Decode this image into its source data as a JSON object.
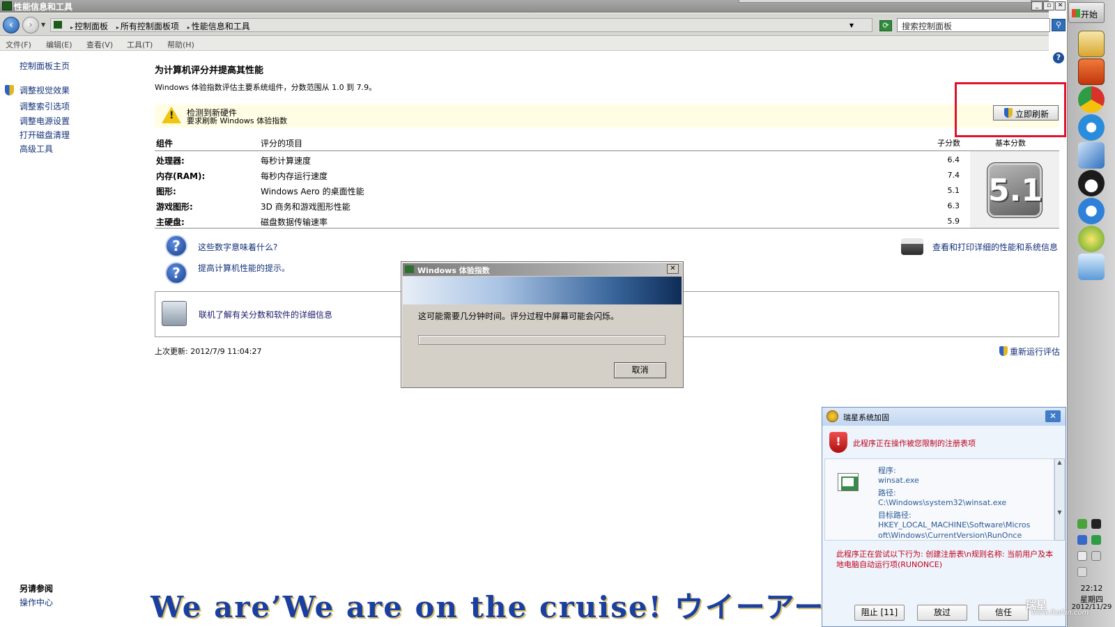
{
  "window": {
    "title": "性能信息和工具",
    "buttons": {
      "minimize": "_",
      "restore": "▫",
      "close": "✕"
    }
  },
  "address": {
    "crumbs": [
      "控制面板",
      "所有控制面板项",
      "性能信息和工具"
    ],
    "search_placeholder": "搜索控制面板"
  },
  "menu": [
    "文件(F)",
    "编辑(E)",
    "查看(V)",
    "工具(T)",
    "帮助(H)"
  ],
  "sidebar": {
    "home": "控制面板主页",
    "links": [
      "调整视觉效果",
      "调整索引选项",
      "调整电源设置",
      "打开磁盘清理",
      "高级工具"
    ],
    "see_also_title": "另请参阅",
    "see_also_link": "操作中心"
  },
  "main": {
    "heading": "为计算机评分并提高其性能",
    "subheading": "Windows 体验指数评估主要系统组件，分数范围从 1.0 到 7.9。",
    "alert": {
      "line1": "检测到新硬件",
      "line2": "要求刷新 Windows 体验指数"
    },
    "refresh_button": "立即刷新",
    "table": {
      "headers": {
        "component": "组件",
        "rated": "评分的项目",
        "subscore": "子分数",
        "basescore": "基本分数"
      },
      "rows": [
        {
          "component": "处理器:",
          "item": "每秒计算速度",
          "score": "6.4"
        },
        {
          "component": "内存(RAM):",
          "item": "每秒内存运行速度",
          "score": "7.4"
        },
        {
          "component": "图形:",
          "item": "Windows Aero 的桌面性能",
          "score": "5.1"
        },
        {
          "component": "游戏图形:",
          "item": "3D 商务和游戏图形性能",
          "score": "6.3"
        },
        {
          "component": "主硬盘:",
          "item": "磁盘数据传输速率",
          "score": "5.9"
        }
      ],
      "base_score": "5.1"
    },
    "help_links": [
      "这些数字意味着什么?",
      "提高计算机性能的提示。"
    ],
    "print_link": "查看和打印详细的性能和系统信息",
    "online_link": "联机了解有关分数和软件的详细信息",
    "last_update": "上次更新: 2012/7/9 11:04:27",
    "rerun_link": "重新运行评估"
  },
  "modal": {
    "title": "Windows 体验指数",
    "message": "这可能需要几分钟时间。评分过程中屏幕可能会闪烁。",
    "cancel": "取消",
    "close": "✕",
    "progress": 0
  },
  "caption": "We are’We are on the cruise! ウイーアー",
  "security_popup": {
    "title": "瑞星系统加固",
    "warning": "此程序正在操作被您限制的注册表项",
    "lines": [
      "程序:",
      "winsat.exe",
      "路径:",
      "C:\\Windows\\system32\\winsat.exe",
      "目标路径:",
      "HKEY_LOCAL_MACHINE\\Software\\Micros",
      "oft\\Windows\\CurrentVersion\\RunOnce"
    ],
    "behavior": "此程序正在尝试以下行为: 创建注册表\\n规则名称: 当前用户及本地电脑自动运行项(RUNONCE)",
    "buttons": [
      "阻止 [11]",
      "放过",
      "信任"
    ],
    "close": "✕"
  },
  "taskbar": {
    "start": "开始",
    "time": "22:12",
    "weekday": "星期四",
    "date": "2012/11/29"
  },
  "watermark": {
    "brand": "瑞星",
    "url": "www.ikafan.com"
  },
  "colors": {
    "link": "#12307a",
    "alert_red": "#c0001a",
    "highlight_box": "#e2102a"
  }
}
